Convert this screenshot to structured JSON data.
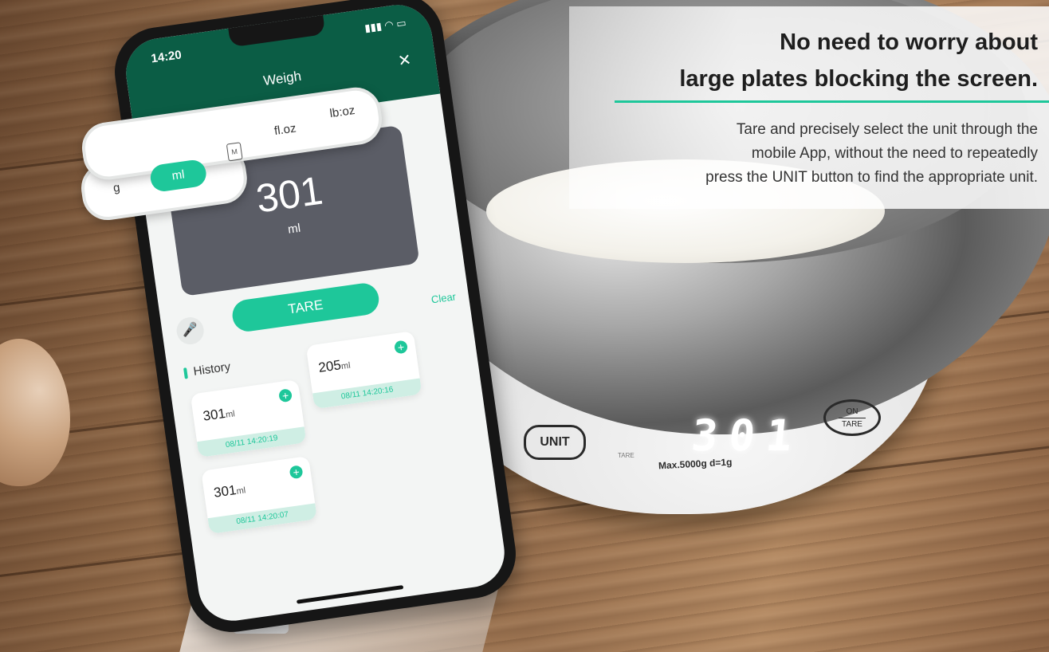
{
  "headline": {
    "line1": "No need to worry about",
    "line2": "large plates blocking the screen."
  },
  "body": {
    "line1": "Tare and precisely select the unit through the",
    "line2": "mobile App, without the need to repeatedly",
    "line3": "press the UNIT button to find the appropriate unit."
  },
  "colors": {
    "accent": "#1ec79a",
    "header": "#0b5d45",
    "reading_card": "#5b5d66"
  },
  "scale": {
    "unit_button": "UNIT",
    "on_label": "ON",
    "tare_label": "TARE",
    "small_tare_label": "TARE",
    "display": "301",
    "spec": "Max.5000g  d=1g"
  },
  "phone": {
    "time": "14:20",
    "status_icons": "signal wifi battery",
    "title": "Weigh",
    "close_icon": "close-icon",
    "reading_value": "301",
    "reading_unit": "ml",
    "tare_button": "TARE",
    "clear": "Clear",
    "history_label": "History",
    "mic_icon": "microphone-icon",
    "history": [
      {
        "value": "301",
        "unit": "ml",
        "timestamp": "08/11 14:20:19"
      },
      {
        "value": "205",
        "unit": "ml",
        "timestamp": "08/11 14:20:16"
      },
      {
        "value": "301",
        "unit": "ml",
        "timestamp": "08/11 14:20:07"
      }
    ]
  },
  "unit_selector": {
    "options": [
      "g",
      "ml",
      "M",
      "fl.oz",
      "lb:oz"
    ],
    "selected": "ml"
  }
}
